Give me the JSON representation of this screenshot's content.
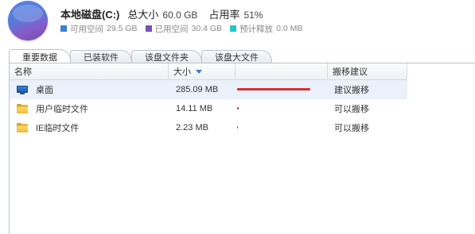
{
  "header": {
    "drive_name": "本地磁盘(C:)",
    "total_label": "总大小",
    "total_value": "60.0 GB",
    "usage_label": "占用率",
    "usage_value": "51%"
  },
  "legend": [
    {
      "label": "可用空间",
      "value": "29.5 GB",
      "color": "#3a7fd5"
    },
    {
      "label": "已用空间",
      "value": "30.4 GB",
      "color": "#7b4fb6"
    },
    {
      "label": "预计释放",
      "value": "0.0 MB",
      "color": "#27c4c4"
    }
  ],
  "tabs": [
    "重要数据",
    "已装软件",
    "该盘文件夹",
    "该盘大文件"
  ],
  "active_tab": 0,
  "table": {
    "columns": [
      "名称",
      "大小",
      "",
      "搬移建议"
    ],
    "sort_column": 1,
    "rows": [
      {
        "icon": "desktop-icon",
        "name": "桌面",
        "size": "285.09 MB",
        "bar_fraction": 1.0,
        "advice": "建议搬移"
      },
      {
        "icon": "folder-icon",
        "name": "用户临时文件",
        "size": "14.11 MB",
        "bar_fraction": 0.02,
        "advice": "可以搬移"
      },
      {
        "icon": "folder-icon",
        "name": "IE临时文件",
        "size": "2.23 MB",
        "bar_fraction": 0.004,
        "advice": "可以搬移"
      }
    ]
  }
}
